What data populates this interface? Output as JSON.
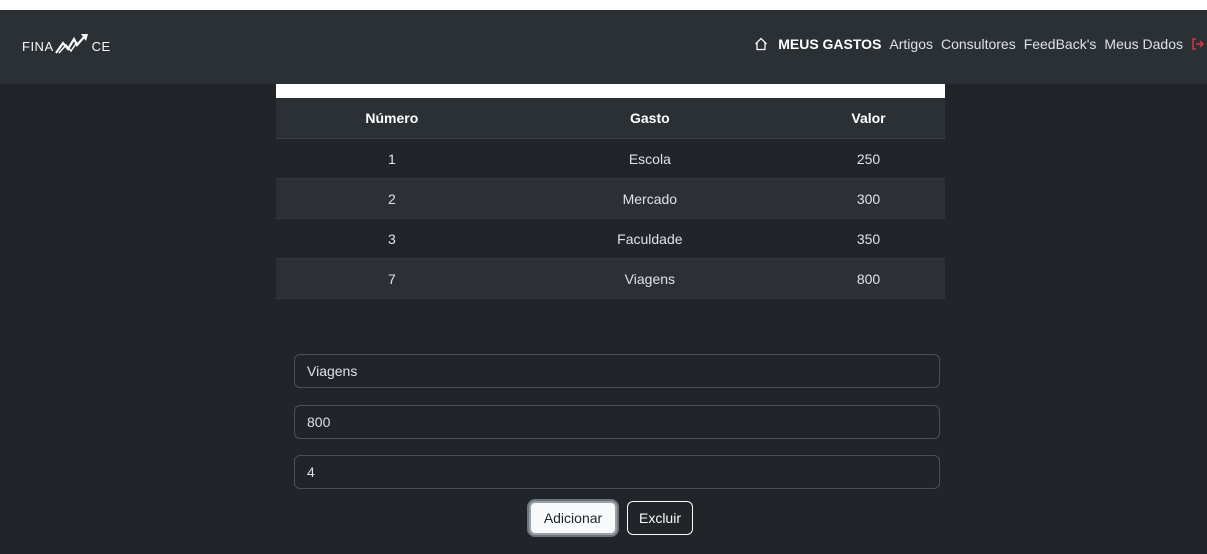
{
  "brand": {
    "left": "FINA",
    "right": "CE"
  },
  "nav": {
    "home_icon": "home-icon",
    "items": [
      "MEUS GASTOS",
      "Artigos",
      "Consultores",
      "FeedBack's",
      "Meus Dados"
    ],
    "logout_icon": "logout-icon",
    "logout_color": "#dc3545"
  },
  "table": {
    "headers": [
      "Número",
      "Gasto",
      "Valor"
    ],
    "rows": [
      [
        "1",
        "Escola",
        "250"
      ],
      [
        "2",
        "Mercado",
        "300"
      ],
      [
        "3",
        "Faculdade",
        "350"
      ],
      [
        "7",
        "Viagens",
        "800"
      ]
    ]
  },
  "form": {
    "gasto_value": "Viagens",
    "valor_value": "800",
    "numero_value": "4"
  },
  "buttons": {
    "add": "Adicionar",
    "delete": "Excluir"
  }
}
